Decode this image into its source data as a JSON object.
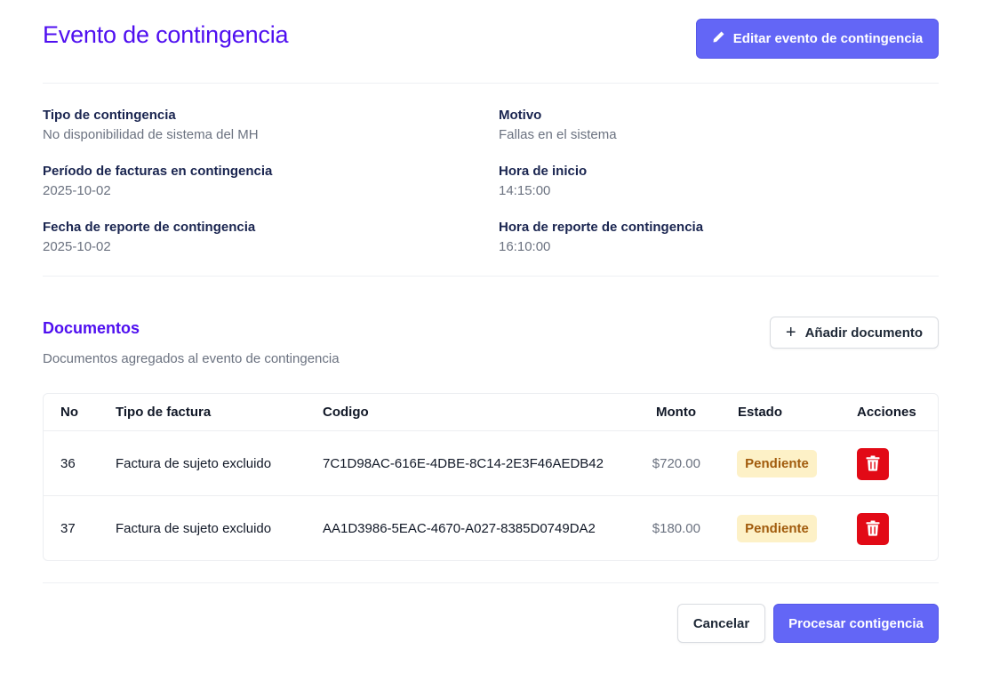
{
  "header": {
    "title": "Evento de contingencia",
    "edit_button": "Editar evento de contingencia",
    "edit_icon": "pencil-icon"
  },
  "details": {
    "tipo_label": "Tipo de contingencia",
    "tipo_value": "No disponibilidad de sistema del MH",
    "motivo_label": "Motivo",
    "motivo_value": "Fallas en el sistema",
    "periodo_label": "Período de facturas en contingencia",
    "periodo_value": "2025-10-02",
    "hora_inicio_label": "Hora de inicio",
    "hora_inicio_value": "14:15:00",
    "fecha_reporte_label": "Fecha de reporte de contingencia",
    "fecha_reporte_value": "2025-10-02",
    "hora_reporte_label": "Hora de reporte de contingencia",
    "hora_reporte_value": "16:10:00"
  },
  "documents": {
    "title": "Documentos",
    "description": "Documentos agregados al evento de contingencia",
    "add_button": "Añadir documento",
    "add_icon": "plus-icon",
    "columns": [
      "No",
      "Tipo de factura",
      "Codigo",
      "Monto",
      "Estado",
      "Acciones"
    ],
    "rows": [
      {
        "no": "36",
        "tipo": "Factura de sujeto excluido",
        "codigo": "7C1D98AC-616E-4DBE-8C14-2E3F46AEDB42",
        "monto": "$720.00",
        "estado": "Pendiente"
      },
      {
        "no": "37",
        "tipo": "Factura de sujeto excluido",
        "codigo": "AA1D3986-5EAC-4670-A027-8385D0749DA2",
        "monto": "$180.00",
        "estado": "Pendiente"
      }
    ],
    "delete_icon": "trash-icon"
  },
  "footer": {
    "cancel_button": "Cancelar",
    "process_button": "Procesar contigencia"
  },
  "colors": {
    "accent": "#4f0ff0",
    "primary_button": "#6366f6",
    "danger": "#e20a16",
    "badge_bg": "#fdf1c7",
    "badge_text": "#a15b0c"
  }
}
